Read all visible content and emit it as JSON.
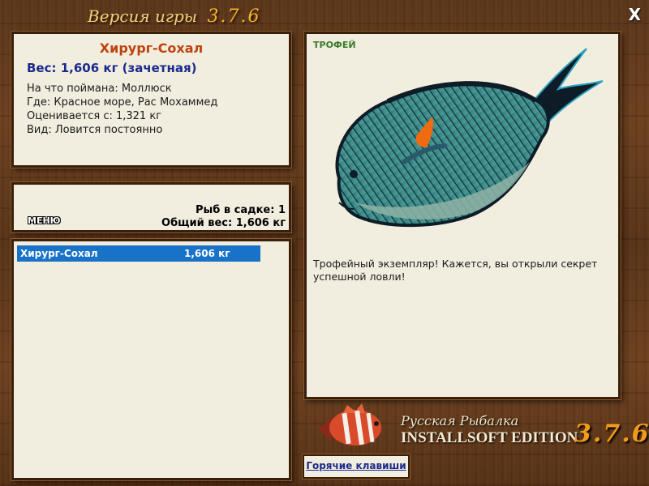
{
  "header": {
    "title": "Версия игры",
    "version": "3.7.6",
    "close_label": "X"
  },
  "fish_info": {
    "name": "Хирург-Сохал",
    "weight": "Вес: 1,606 кг (зачетная)",
    "caught_on": "На что поймана: Моллюск",
    "where": "Где: Красное море, Рас Мохаммед",
    "rated_from": "Оценивается с: 1,321 кг",
    "type": "Вид: Ловится постоянно"
  },
  "keepnet": {
    "menu_label": "МЕНЮ",
    "fish_count": "Рыб в садке: 1",
    "total_weight": "Общий вес: 1,606 кг"
  },
  "catch_list": [
    {
      "name": "Хирург-Сохал",
      "weight": "1,606 кг"
    }
  ],
  "trophy": {
    "label": "ТРОФЕЙ",
    "description": "Трофейный экземпляр! Кажется, вы открыли секрет успешной ловли!",
    "icon": "sohal-surgeonfish-image"
  },
  "branding": {
    "line1": "Русская Рыбалка",
    "line2": "INSTALLSOFT EDITION",
    "version": "3.7.6"
  },
  "footer": {
    "hotkeys_label": "Горячие клавиши"
  },
  "colors": {
    "fish_name": "#c0420e",
    "weight": "#1b2a8c",
    "selection": "#1872c8",
    "trophy_label": "#3a7a2a",
    "version_accent": "#f29a1c"
  }
}
